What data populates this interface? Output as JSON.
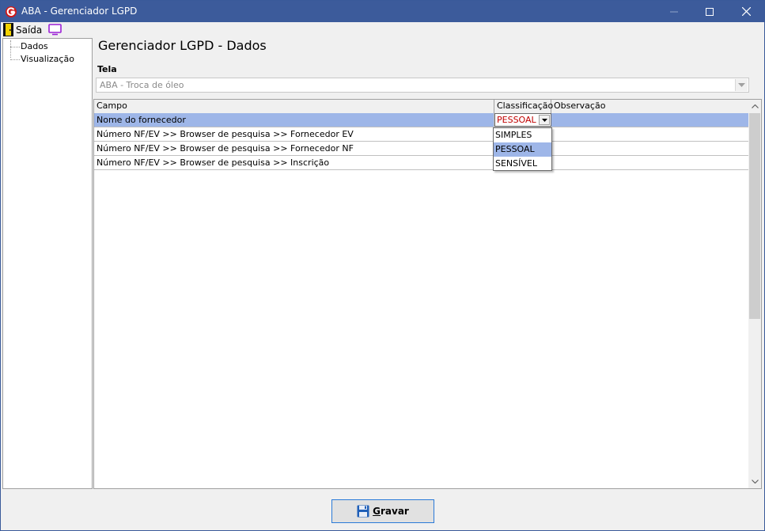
{
  "window": {
    "title": "ABA - Gerenciador LGPD",
    "accent_color": "#3c5b9b"
  },
  "menu": {
    "exit_label": "Saída",
    "exit_icon": "door-exit-icon",
    "monitor_icon": "monitor-icon"
  },
  "tree": {
    "items": [
      {
        "label": "Dados"
      },
      {
        "label": "Visualização"
      }
    ]
  },
  "main": {
    "title": "Gerenciador LGPD - Dados",
    "tela_label": "Tela",
    "tela_value": "ABA - Troca de óleo"
  },
  "grid": {
    "columns": [
      "Campo",
      "Classificação",
      "Observação"
    ],
    "rows": [
      {
        "campo": "Nome do fornecedor",
        "classificacao": "PESSOAL",
        "observacao": "",
        "selected": true
      },
      {
        "campo": "Número NF/EV >> Browser de pesquisa >> Fornecedor EV",
        "classificacao": "",
        "observacao": ""
      },
      {
        "campo": "Número NF/EV >> Browser de pesquisa >> Fornecedor NF",
        "classificacao": "",
        "observacao": ""
      },
      {
        "campo": "Número NF/EV >> Browser de pesquisa >> Inscrição",
        "classificacao": "",
        "observacao": ""
      }
    ],
    "selection_color": "#9eb6e8"
  },
  "dropdown": {
    "options": [
      "SIMPLES",
      "PESSOAL",
      "SENSÍVEL"
    ],
    "highlighted": "PESSOAL",
    "editor_text_color": "#c00000"
  },
  "footer": {
    "save_label_underlined": "G",
    "save_label_rest": "ravar",
    "save_icon": "floppy-disk-icon"
  }
}
